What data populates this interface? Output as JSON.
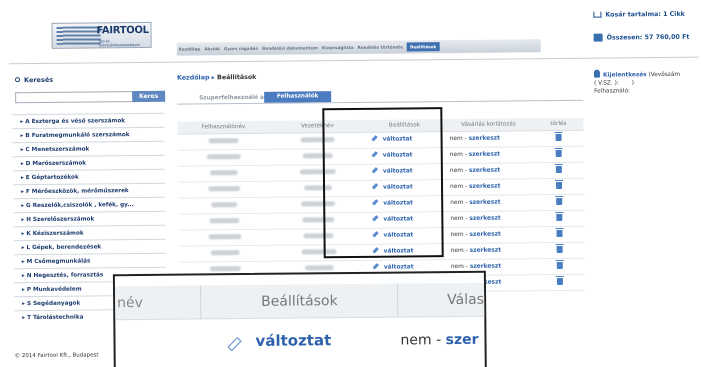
{
  "header": {
    "logo_brand": "FAIRTOOL",
    "logo_tag": "Tép és Szerszámkereskedelem",
    "cart_label": "Kosár tartalma: 1 Cikk",
    "total_label": "Összesen: 57 760,00 Ft"
  },
  "nav": {
    "items": [
      "Kezdőlap",
      "Akciók",
      "Gyors rögzítés",
      "Rendelési dokumentum",
      "Kívánságlista",
      "Rendelés története",
      "Beállítások"
    ],
    "active_index": 6
  },
  "sidebar": {
    "search_title": "Keresés",
    "search_button": "Keres",
    "categories": [
      "A Eszterga és véső szerszámok",
      "B Furatmegmunkáló szerszámok",
      "C Menetszerszámok",
      "D Marószerszámok",
      "E Géptartozékok",
      "F Mérőeszközök, mérőműszerek",
      "G Reszelők,csiszolók , kefék, gy...",
      "H Szerelőszerszámok",
      "K Kéziszerszámok",
      "L Gépek, berendezések",
      "M Csőmegmunkálás",
      "N Hegesztés, forrasztás",
      "P Munkavédelem",
      "S Segédanyagok",
      "T Tárolástechnika"
    ],
    "footer": "© 2014 Fairtool Kft., Budapest"
  },
  "breadcrumb": {
    "home": "Kezdőlap",
    "sep": "▸",
    "current": "Beállítások"
  },
  "tabs": {
    "inactive": "Szuperfelhasználó adatok",
    "active": "Felhasználók"
  },
  "table": {
    "headers": [
      "Felhasználónév",
      "Vezetéknév",
      "Beállítások",
      "Vásárlás korlátozás",
      "törlés"
    ],
    "action_label": "változtat",
    "limit_no": "nem",
    "limit_dash": "-",
    "limit_edit": "szerkeszt",
    "row_count": 10
  },
  "login": {
    "link": "Kijelentkezés",
    "name": "(Vevőszám",
    "code": "( V.SZ. ):",
    "close": ")",
    "user_label": "Felhasználó:"
  },
  "zoom": {
    "col1": "név",
    "col2": "Beállítások",
    "col3": "Válas",
    "action": "változtat",
    "limit_no": "nem",
    "limit_dash": "-",
    "limit_edit": "szer"
  },
  "colors": {
    "brand": "#1d3c6e",
    "accent": "#2e62ad",
    "tab_active": "#4b7cc1"
  }
}
